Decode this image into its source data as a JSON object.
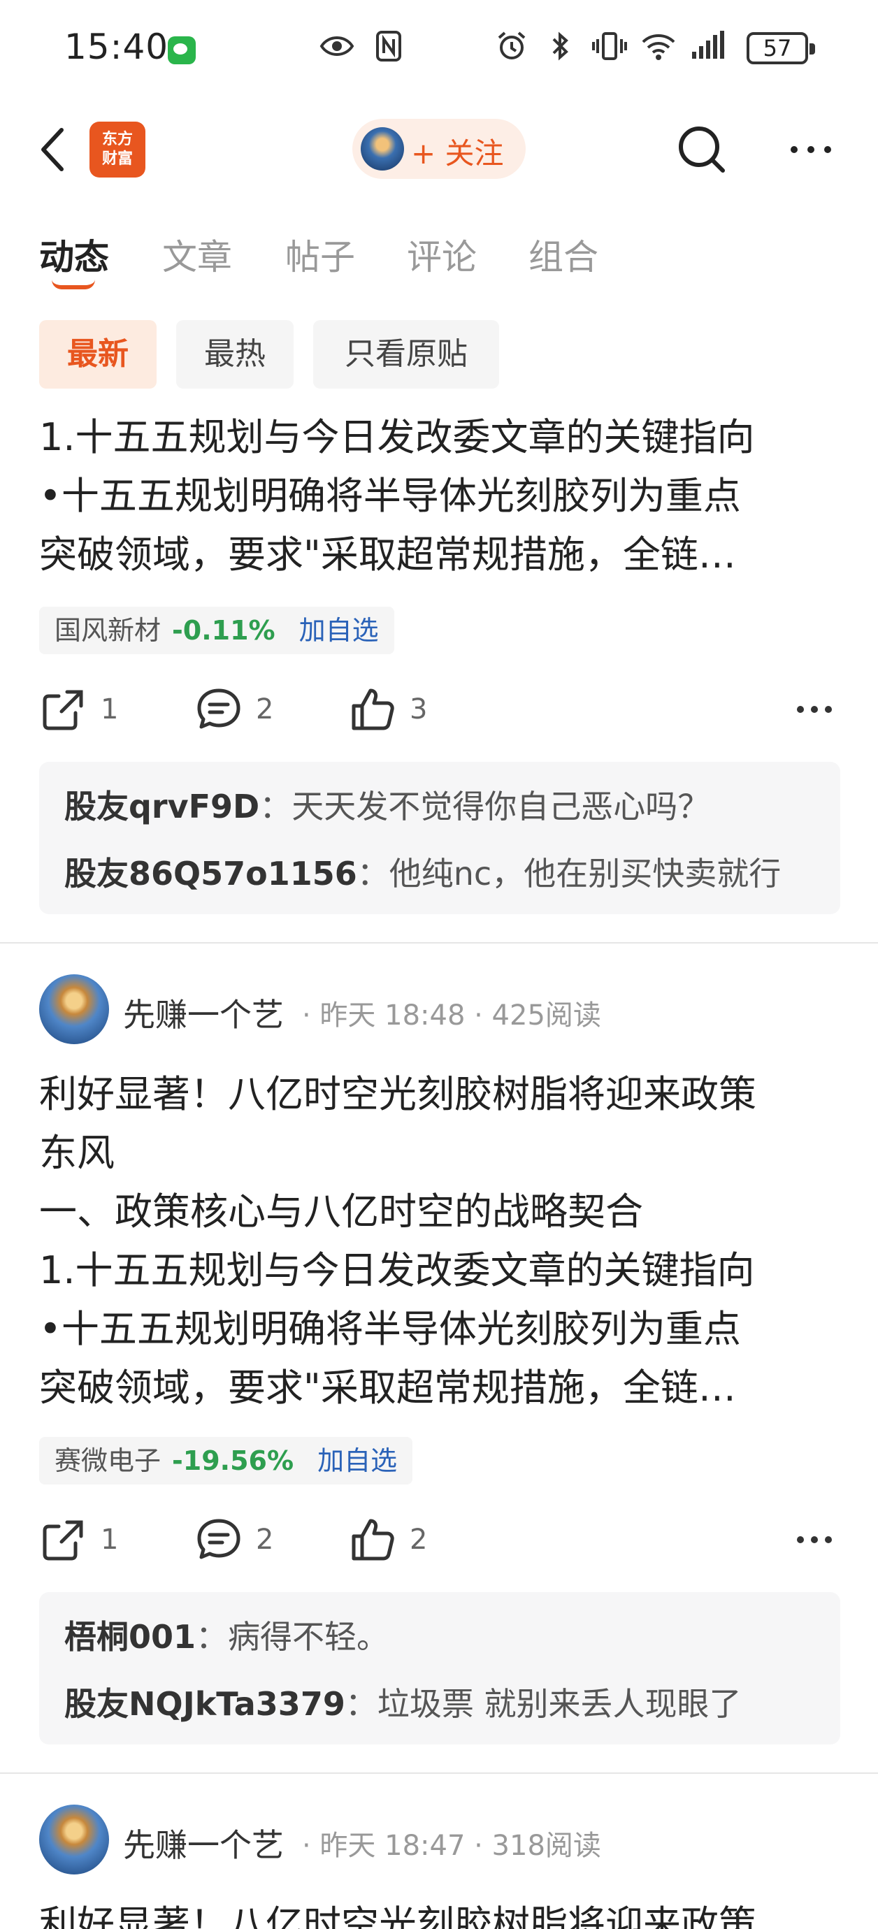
{
  "status_bar": {
    "time": "15:40",
    "battery": "57",
    "icons": [
      "wechat-icon",
      "eye-icon",
      "nfc-icon",
      "alarm-icon",
      "bluetooth-icon",
      "vibrate-icon",
      "wifi-icon",
      "signal-icon"
    ]
  },
  "nav": {
    "logo_line1": "东方",
    "logo_line2": "财富",
    "follow_label": "+ 关注",
    "accent": "#e8561f"
  },
  "tabs": [
    {
      "label": "动态",
      "active": true
    },
    {
      "label": "文章",
      "active": false
    },
    {
      "label": "帖子",
      "active": false
    },
    {
      "label": "评论",
      "active": false
    },
    {
      "label": "组合",
      "active": false
    }
  ],
  "filters": [
    {
      "label": "最新",
      "active": true
    },
    {
      "label": "最热",
      "active": false
    },
    {
      "label": "只看原贴",
      "active": false
    }
  ],
  "posts": [
    {
      "lines": [
        "1.十五五规划与今日发改委文章的关键指向",
        "•十五五规划明确将半导体光刻胶列为重点",
        "突破领域，要求\"采取超常规措施，全链…"
      ],
      "stock": {
        "name": "国风新材",
        "change": "-0.11%",
        "add": "加自选"
      },
      "share_count": "1",
      "comment_count": "2",
      "like_count": "3",
      "comments": [
        {
          "user": "股友qrvF9D",
          "text": "天天发不觉得你自己恶心吗？"
        },
        {
          "user": "股友86Q57o1156",
          "text": "他纯nc，他在别买快卖就行"
        }
      ]
    },
    {
      "author": "先赚一个艺",
      "meta": "· 昨天 18:48 · 425阅读",
      "lines": [
        "利好显著！八亿时空光刻胶树脂将迎来政策",
        "东风",
        "一、政策核心与八亿时空的战略契合",
        "1.十五五规划与今日发改委文章的关键指向",
        "•十五五规划明确将半导体光刻胶列为重点",
        "突破领域，要求\"采取超常规措施，全链…"
      ],
      "stock": {
        "name": "赛微电子",
        "change": "-19.56%",
        "add": "加自选"
      },
      "share_count": "1",
      "comment_count": "2",
      "like_count": "2",
      "comments": [
        {
          "user": "梧桐001",
          "text": "病得不轻。"
        },
        {
          "user": "股友NQJkTa3379",
          "text": "垃圾票 就别来丢人现眼了"
        }
      ]
    },
    {
      "author": "先赚一个艺",
      "meta": "· 昨天 18:47 · 318阅读",
      "lines": [
        "利好显著！八亿时空光刻胶树脂将迎来政策"
      ]
    }
  ]
}
